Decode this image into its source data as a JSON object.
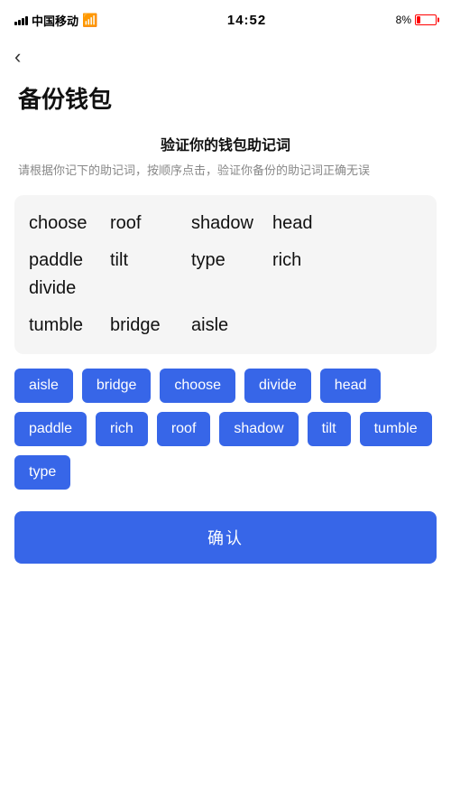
{
  "statusBar": {
    "carrier": "中国移动",
    "time": "14:52",
    "battery_pct": "8%",
    "wifi": "WiFi"
  },
  "back": {
    "label": "‹"
  },
  "pageTitle": "备份钱包",
  "section": {
    "heading": "验证你的钱包助记词",
    "desc": "请根据你记下的助记词，按顺序点击，验证你备份的助记词正确无误"
  },
  "displayWords": {
    "row1": [
      "choose",
      "roof",
      "shadow",
      "head"
    ],
    "row2": [
      "paddle",
      "tilt",
      "type",
      "rich",
      "divide"
    ],
    "row3": [
      "tumble",
      "bridge",
      "aisle"
    ]
  },
  "chips": [
    "aisle",
    "bridge",
    "choose",
    "divide",
    "head",
    "paddle",
    "rich",
    "roof",
    "shadow",
    "tilt",
    "tumble",
    "type"
  ],
  "confirmBtn": "确认"
}
